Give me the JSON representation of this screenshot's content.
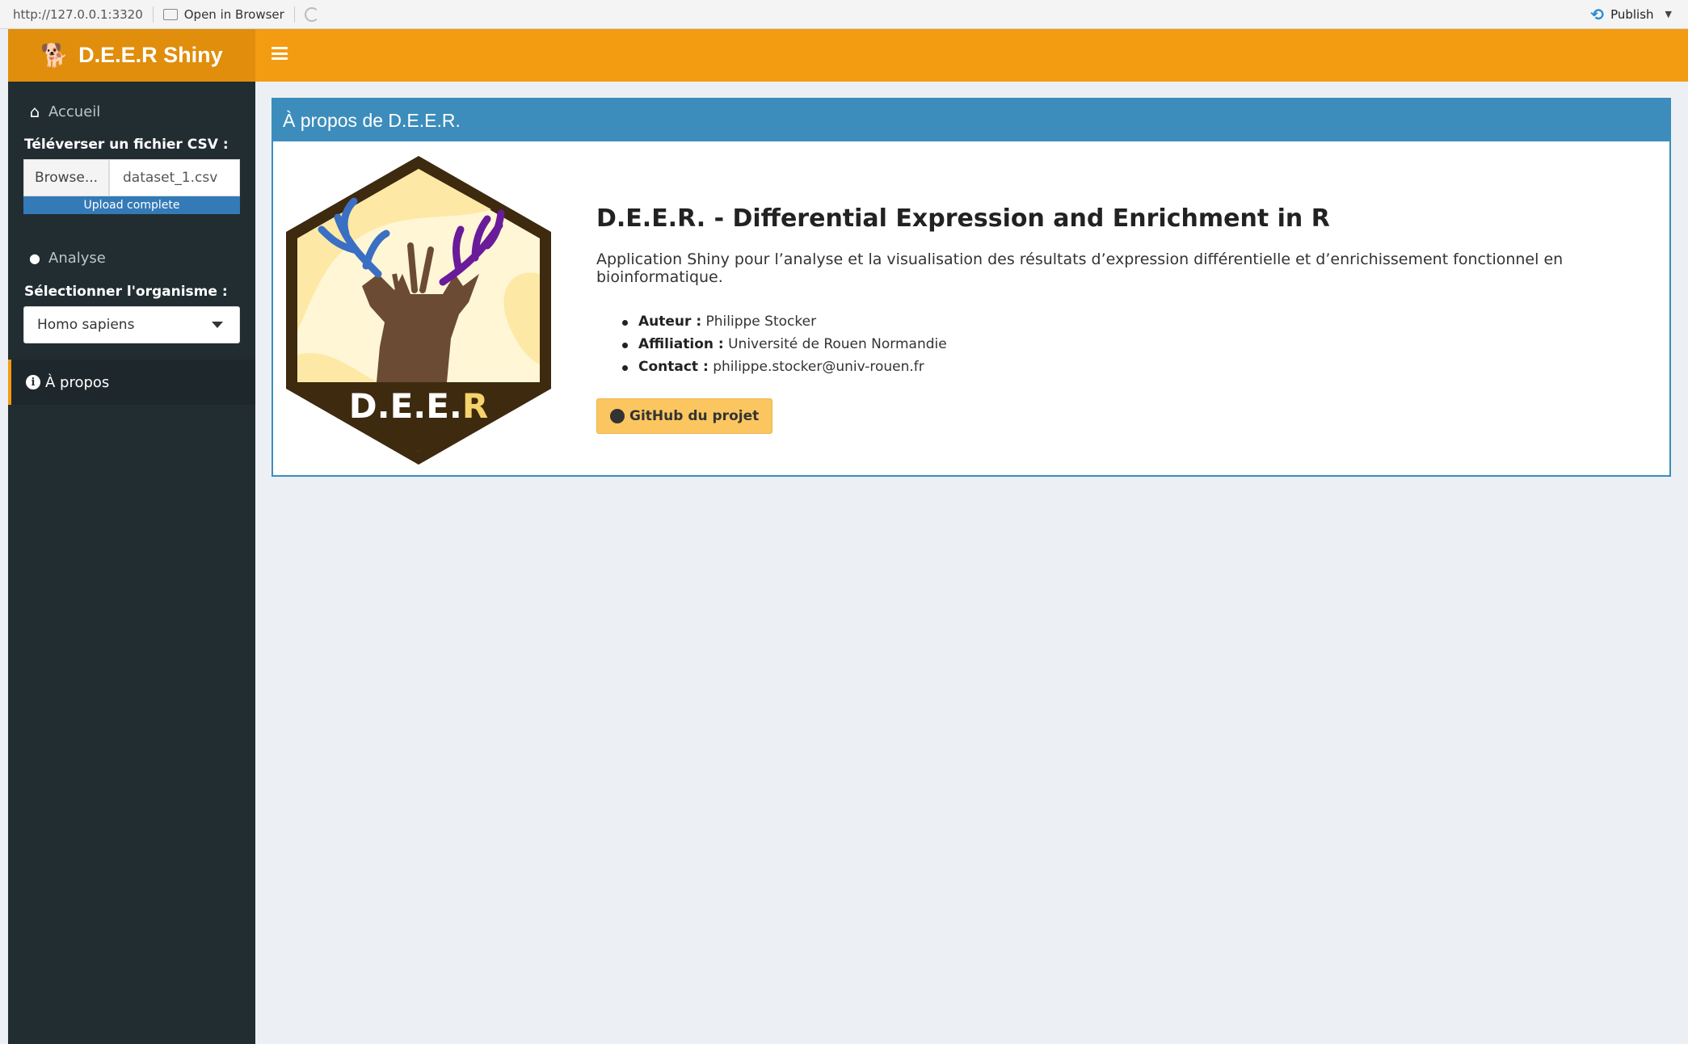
{
  "viewer": {
    "url": "http://127.0.0.1:3320",
    "open_in_browser": "Open in Browser",
    "publish": "Publish"
  },
  "header": {
    "title": "D.E.E.R Shiny"
  },
  "sidebar": {
    "home_label": "Accueil",
    "upload_label": "Téléverser un fichier CSV :",
    "browse_label": "Browse...",
    "file_name": "dataset_1.csv",
    "upload_status": "Upload complete",
    "upload_progress": 1.0,
    "analysis_label": "Analyse",
    "organism_label": "Sélectionner l'organisme :",
    "organism_value": "Homo sapiens",
    "about_label": "À propos"
  },
  "box": {
    "title": "À propos de D.E.E.R.",
    "logo_text_main": "D.E.E.",
    "logo_text_accent": "R",
    "heading": "D.E.E.R. - Differential Expression and Enrichment in R",
    "description": "Application Shiny pour l’analyse et la visualisation des résultats d’expression différentielle et d’enrichissement fonctionnel en bioinformatique.",
    "author_key": "Auteur :",
    "author_value": "Philippe Stocker",
    "affiliation_key": "Affiliation :",
    "affiliation_value": "Université de Rouen Normandie",
    "contact_key": "Contact :",
    "contact_value": "philippe.stocker@univ-rouen.fr",
    "github_label": "GitHub du projet"
  },
  "colors": {
    "header_orange": "#f39c12",
    "logo_orange": "#e08e0b",
    "sidebar_dark": "#222d32",
    "box_blue": "#3c8dbc",
    "button_yellow": "#fbc660"
  }
}
